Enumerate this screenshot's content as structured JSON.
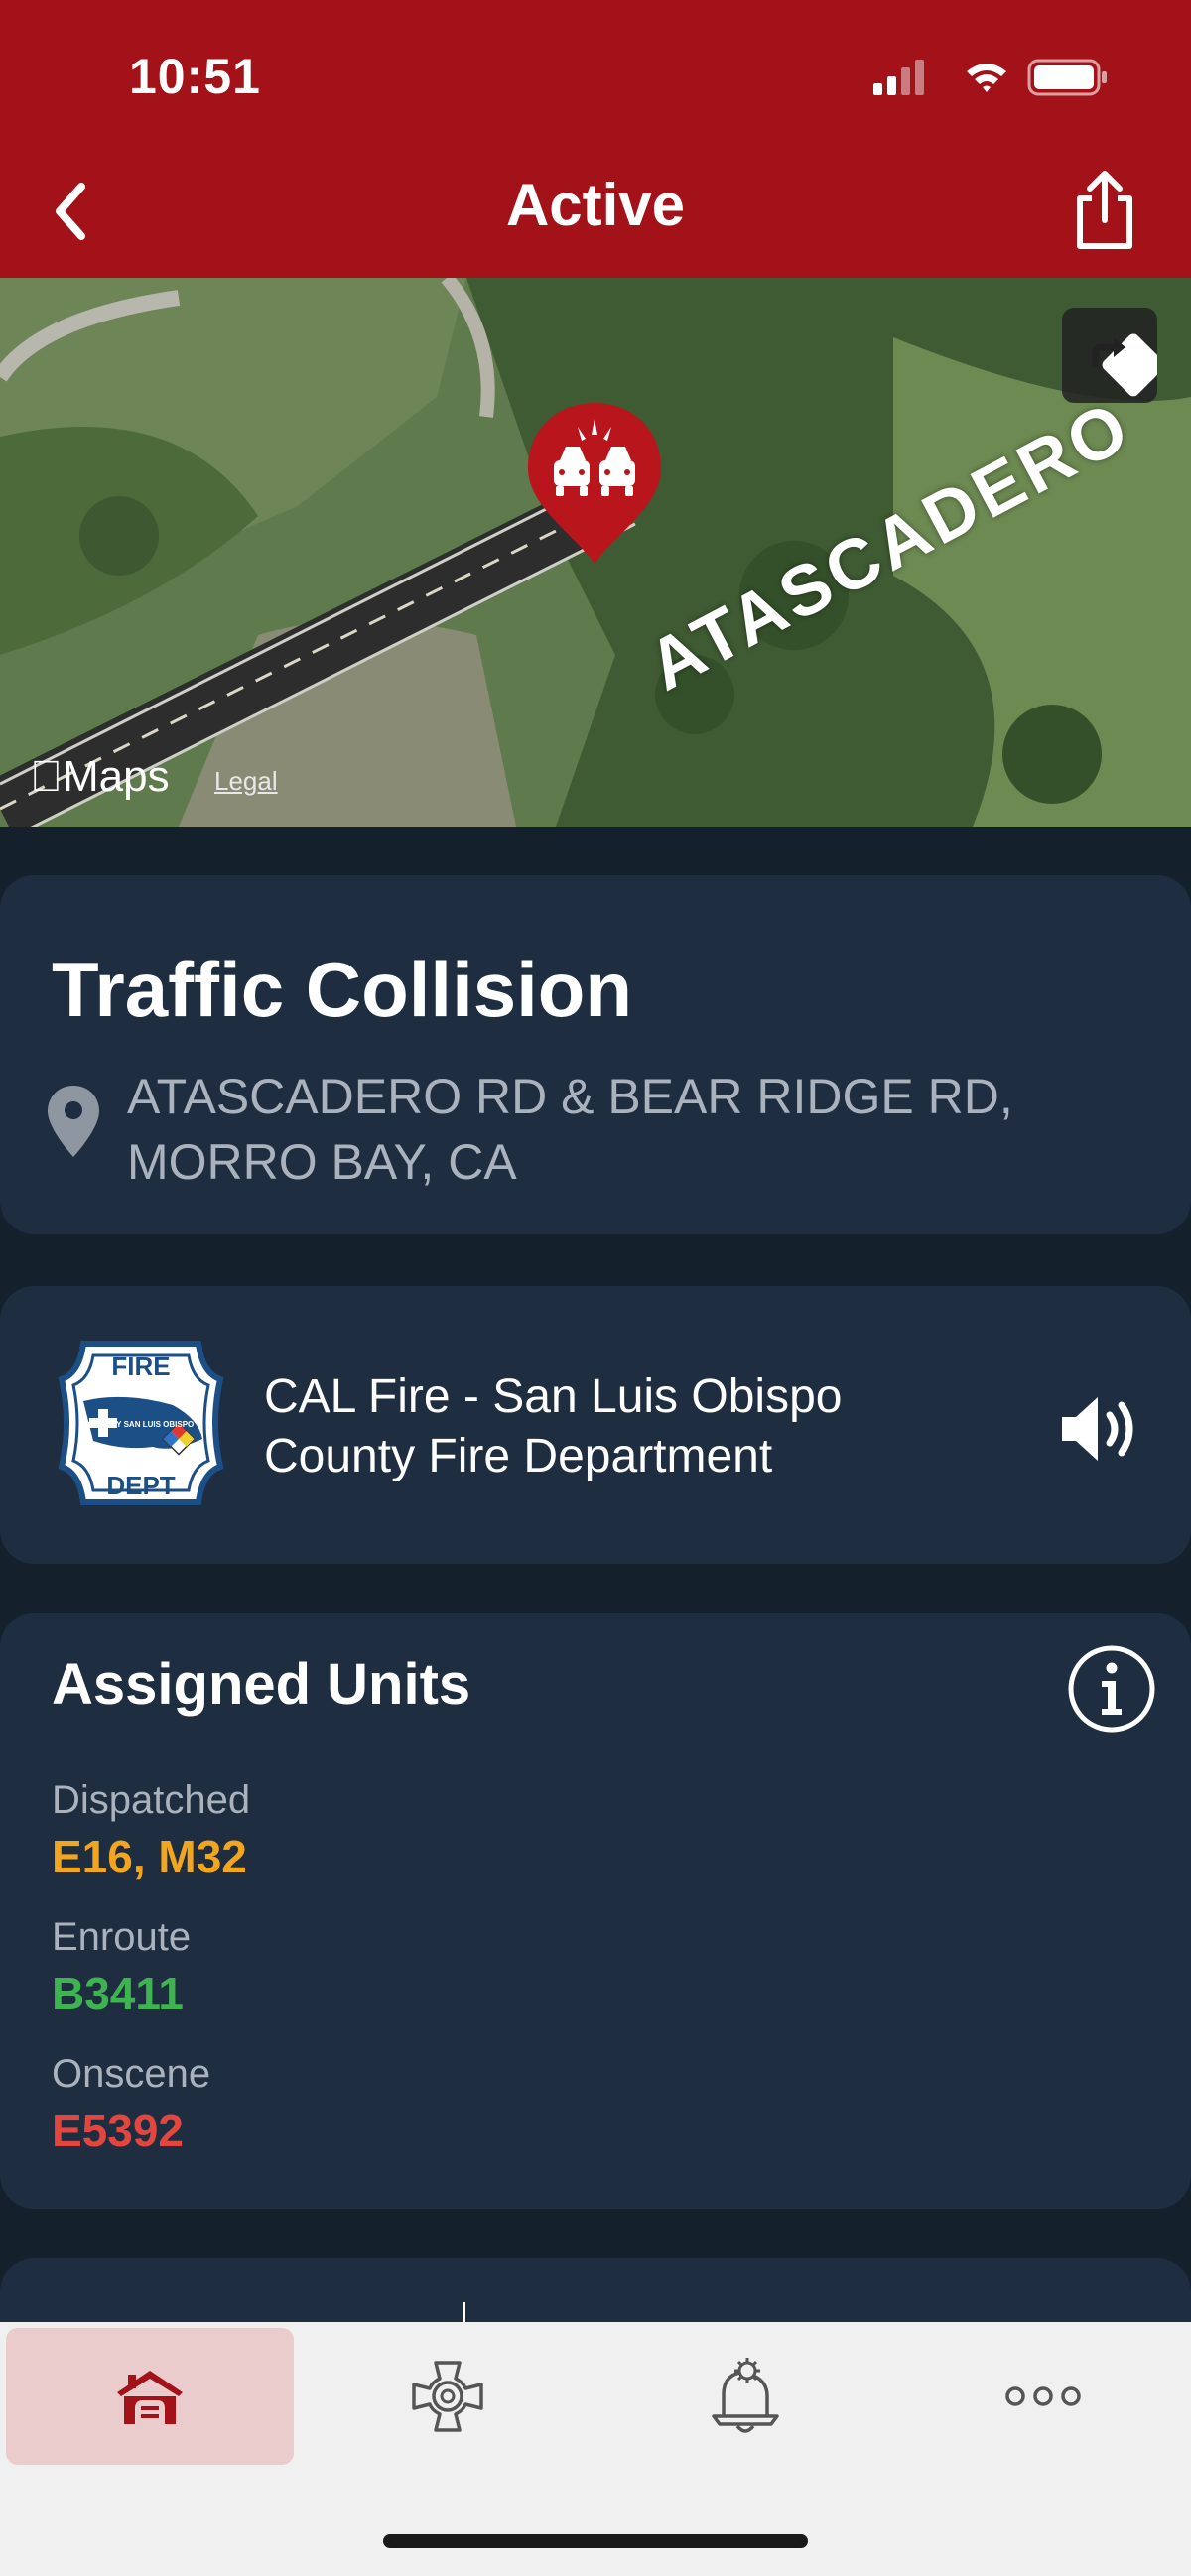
{
  "status_bar": {
    "time": "10:51"
  },
  "header": {
    "title": "Active"
  },
  "map": {
    "road_label": "ATASCADERO",
    "attribution": "Maps",
    "legal": "Legal"
  },
  "incident": {
    "type": "Traffic Collision",
    "address": "ATASCADERO RD & BEAR RIDGE RD, MORRO BAY, CA"
  },
  "agency": {
    "name": "CAL Fire - San Luis Obispo County Fire Department",
    "logo_text_top": "FIRE",
    "logo_text_bottom": "DEPT",
    "logo_inner": "COUNTY SAN LUIS OBISPO"
  },
  "assigned_units": {
    "title": "Assigned Units",
    "groups": [
      {
        "label": "Dispatched",
        "units": "E16, M32",
        "color": "#f2a51e"
      },
      {
        "label": "Enroute",
        "units": "B3411",
        "color": "#3fb351"
      },
      {
        "label": "Onscene",
        "units": "E5392",
        "color": "#e2463f"
      }
    ]
  },
  "tabs": [
    {
      "name": "home",
      "icon": "firehouse-icon",
      "active": true
    },
    {
      "name": "department",
      "icon": "maltese-cross-icon",
      "active": false
    },
    {
      "name": "alerts",
      "icon": "bell-gear-icon",
      "active": false
    },
    {
      "name": "more",
      "icon": "ellipsis-icon",
      "active": false
    }
  ],
  "colors": {
    "header": "#a31218",
    "background": "#15202d",
    "card": "#1e2d40"
  }
}
